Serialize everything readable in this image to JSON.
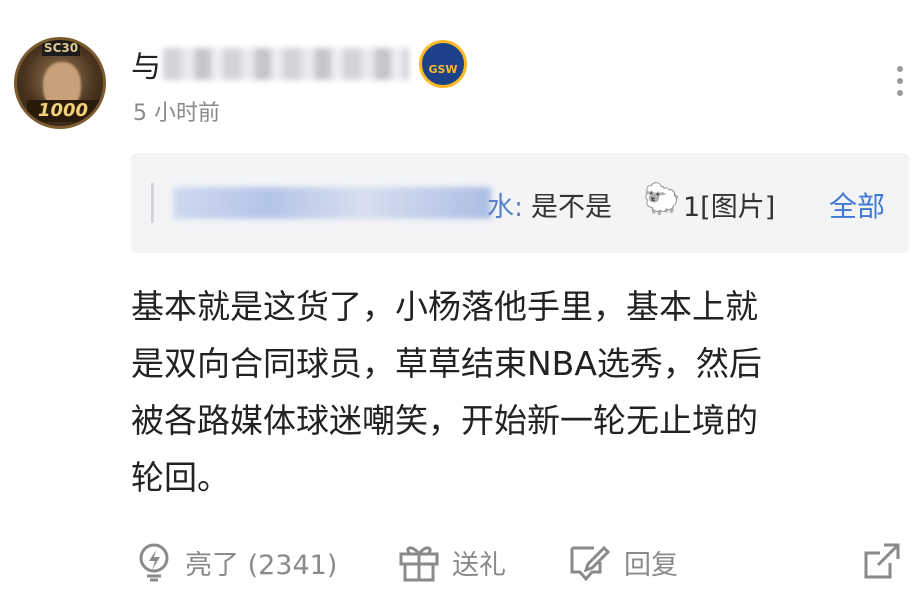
{
  "post": {
    "avatar": {
      "top_badge": "SC30",
      "bottom_badge": "1000"
    },
    "username_first_char": "与",
    "team_badge": "GSW",
    "time": "5 小时前",
    "quote": {
      "user_suffix": "水:",
      "text_before": "是不是",
      "sheep_emoji": "🐑",
      "text_after": "1[图片]",
      "all_label": "全部"
    },
    "body_lines": [
      "基本就是这货了，小杨落他手里，基本上就",
      "是双向合同球员，草草结束NBA选秀，然后",
      "被各路媒体球迷嘲笑，开始新一轮无止境的",
      "轮回。"
    ],
    "actions": {
      "like_label": "亮了 (2341)",
      "gift_label": "送礼",
      "reply_label": "回复"
    }
  }
}
